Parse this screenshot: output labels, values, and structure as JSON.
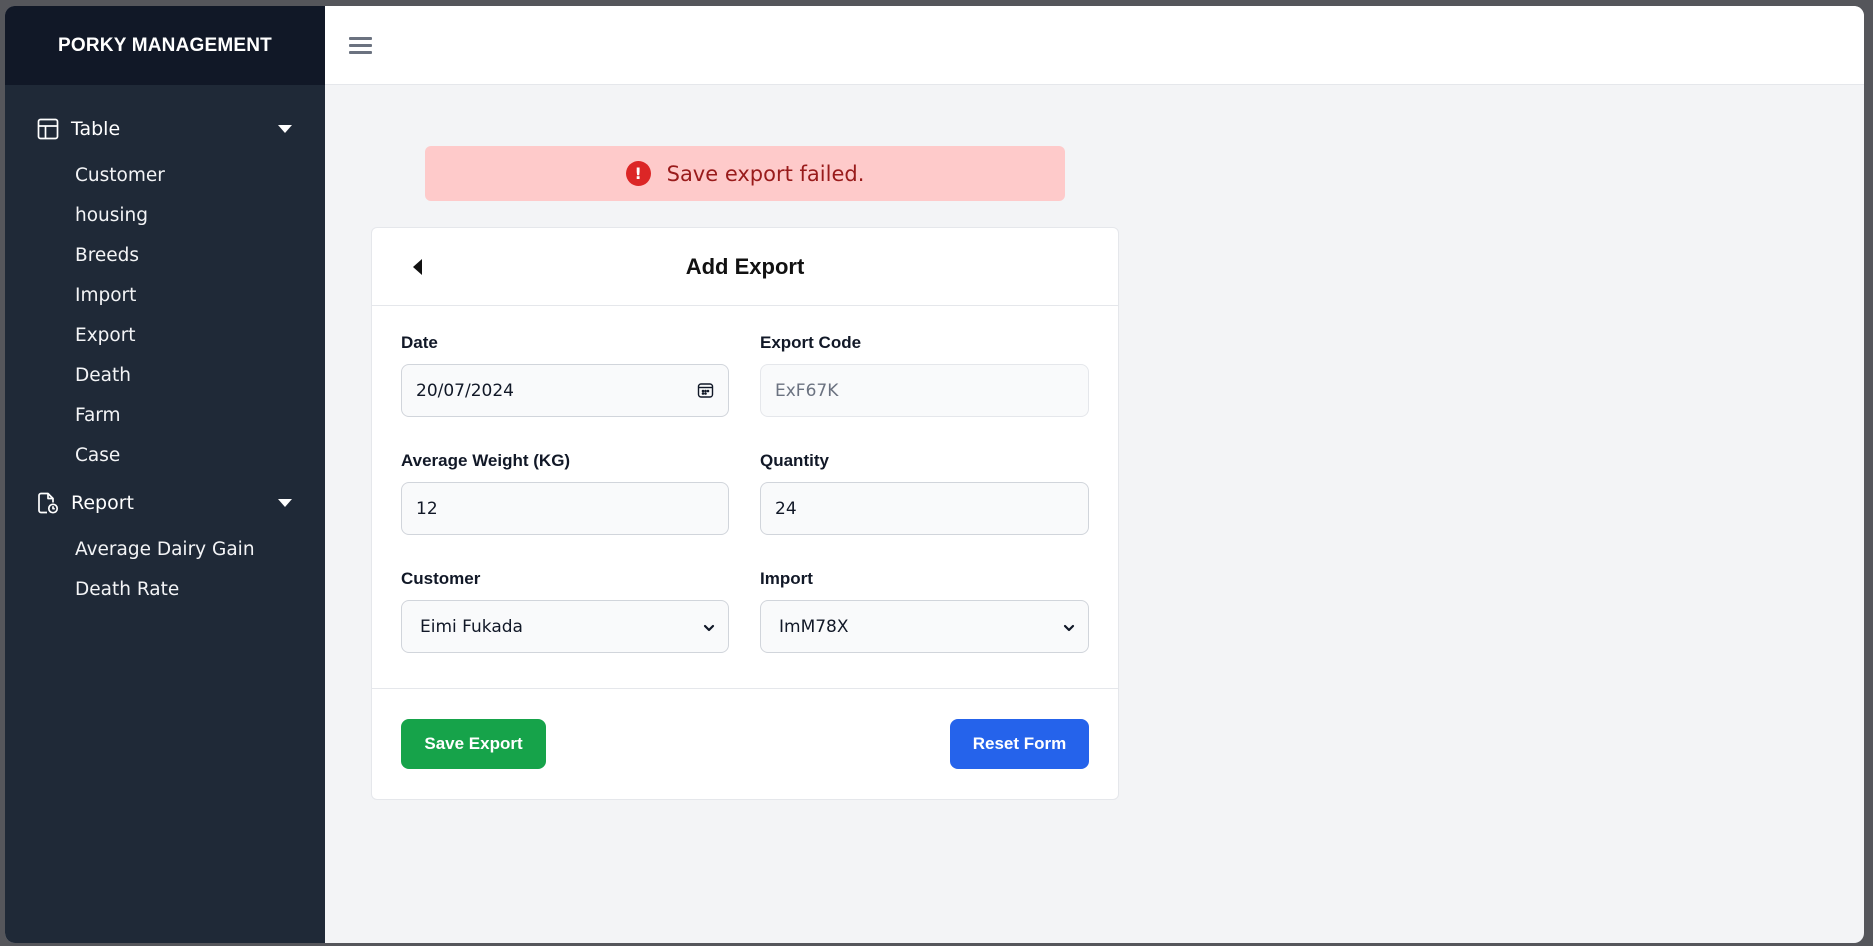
{
  "app": {
    "brand": "PORKY MANAGEMENT"
  },
  "sidebar": {
    "groups": [
      {
        "label": "Table",
        "icon": "table-icon",
        "expanded": true,
        "items": [
          "Customer",
          "housing",
          "Breeds",
          "Import",
          "Export",
          "Death",
          "Farm",
          "Case"
        ]
      },
      {
        "label": "Report",
        "icon": "report-icon",
        "expanded": true,
        "items": [
          "Average Dairy Gain",
          "Death Rate"
        ]
      }
    ]
  },
  "header": {
    "menu_icon": "hamburger-icon"
  },
  "alert": {
    "type": "error",
    "icon": "exclamation-circle-icon",
    "message": "Save export failed."
  },
  "form": {
    "title": "Add Export",
    "back_icon": "caret-left-icon",
    "fields": {
      "date": {
        "label": "Date",
        "value": "20/07/2024",
        "icon": "calendar-icon"
      },
      "export_code": {
        "label": "Export Code",
        "value": "ExF67K",
        "disabled": true
      },
      "average_weight": {
        "label": "Average Weight (KG)",
        "value": "12"
      },
      "quantity": {
        "label": "Quantity",
        "value": "24"
      },
      "customer": {
        "label": "Customer",
        "selected": "Eimi Fukada"
      },
      "import": {
        "label": "Import",
        "selected": "ImM78X"
      }
    },
    "buttons": {
      "save": "Save Export",
      "reset": "Reset Form"
    }
  },
  "colors": {
    "sidebar_bg": "#1f2937",
    "brand_bg": "#111827",
    "main_bg": "#f3f4f6",
    "alert_bg": "#fecaca",
    "alert_text": "#991b1b",
    "alert_icon": "#dc2626",
    "save_button": "#16a34a",
    "reset_button": "#2563eb"
  }
}
